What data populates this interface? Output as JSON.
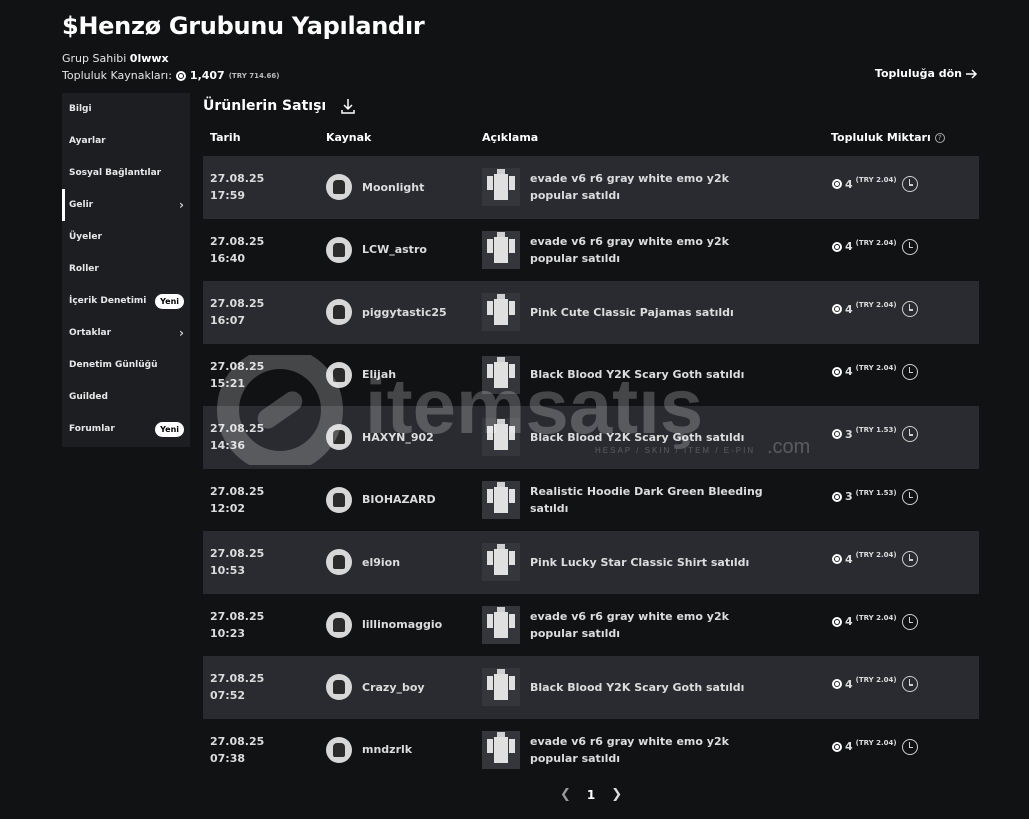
{
  "header": {
    "title": "$Henzø Grubunu Yapılandır",
    "owner_label": "Grup Sahibi",
    "owner_name": "0lwwx",
    "funds_label": "Topluluk Kaynakları:",
    "funds_amount": "1,407",
    "funds_try": "(TRY 714.66)",
    "back_link": "Topluluğa dön"
  },
  "sidebar": {
    "items": [
      {
        "label": "Bilgi"
      },
      {
        "label": "Ayarlar"
      },
      {
        "label": "Sosyal Bağlantılar"
      },
      {
        "label": "Gelir",
        "active": true,
        "chevron": true
      },
      {
        "label": "Üyeler"
      },
      {
        "label": "Roller"
      },
      {
        "label": "İçerik Denetimi",
        "badge": "Yeni"
      },
      {
        "label": "Ortaklar",
        "chevron": true
      },
      {
        "label": "Denetim Günlüğü"
      },
      {
        "label": "Guilded"
      },
      {
        "label": "Forumlar",
        "badge": "Yeni"
      }
    ]
  },
  "section": {
    "title": "Ürünlerin Satışı"
  },
  "table": {
    "headers": {
      "date": "Tarih",
      "source": "Kaynak",
      "description": "Açıklama",
      "amount": "Topluluk Miktarı"
    },
    "rows": [
      {
        "date": "27.08.25\n17:59",
        "user": "Moonlight",
        "desc": "evade v6 r6 gray white emo y2k popular satıldı",
        "amount": "4",
        "try": "(TRY 2.04)"
      },
      {
        "date": "27.08.25\n16:40",
        "user": "LCW_astro",
        "desc": "evade v6 r6 gray white emo y2k popular satıldı",
        "amount": "4",
        "try": "(TRY 2.04)"
      },
      {
        "date": "27.08.25\n16:07",
        "user": "piggytastic25",
        "desc": "Pink Cute Classic Pajamas satıldı",
        "amount": "4",
        "try": "(TRY 2.04)"
      },
      {
        "date": "27.08.25\n15:21",
        "user": "Elijah",
        "desc": "Black Blood Y2K Scary Goth satıldı",
        "amount": "4",
        "try": "(TRY 2.04)"
      },
      {
        "date": "27.08.25\n14:36",
        "user": "HAXYN_902",
        "desc": "Black Blood Y2K Scary Goth satıldı",
        "amount": "3",
        "try": "(TRY 1.53)"
      },
      {
        "date": "27.08.25\n12:02",
        "user": "BIOHAZARD",
        "desc": "Realistic Hoodie Dark Green Bleeding satıldı",
        "amount": "3",
        "try": "(TRY 1.53)"
      },
      {
        "date": "27.08.25\n10:53",
        "user": "el9ion",
        "desc": "Pink Lucky Star Classic Shirt satıldı",
        "amount": "4",
        "try": "(TRY 2.04)"
      },
      {
        "date": "27.08.25\n10:23",
        "user": "lillinomaggio",
        "desc": "evade v6 r6 gray white emo y2k popular satıldı",
        "amount": "4",
        "try": "(TRY 2.04)"
      },
      {
        "date": "27.08.25\n07:52",
        "user": "Crazy_boy",
        "desc": "Black Blood Y2K Scary Goth satıldı",
        "amount": "4",
        "try": "(TRY 2.04)"
      },
      {
        "date": "27.08.25\n07:38",
        "user": "mndzrlk",
        "desc": "evade v6 r6 gray white emo y2k popular satıldı",
        "amount": "4",
        "try": "(TRY 2.04)"
      }
    ]
  },
  "pagination": {
    "current_page": "1"
  },
  "watermark": {
    "brand": "itemsatış",
    "tagline": "HESAP / SKIN / ITEM / E-PIN",
    "suffix": ".com"
  },
  "icons": {
    "robux": "robux-icon",
    "download": "download-icon",
    "clock": "clock-icon",
    "help": "question-icon",
    "arrow_right": "arrow-right-icon"
  }
}
